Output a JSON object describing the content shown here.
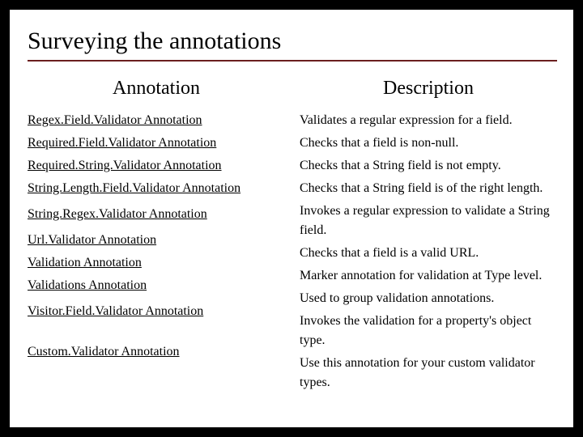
{
  "title": "Surveying the annotations",
  "headers": {
    "left": "Annotation",
    "right": "Description"
  },
  "rows": [
    {
      "annotation": "Regex.Field.Validator Annotation",
      "description": "Validates a regular expression for a field."
    },
    {
      "annotation": "Required.Field.Validator Annotation",
      "description": "Checks that a field is non-null."
    },
    {
      "annotation": "Required.String.Validator Annotation",
      "description": "Checks that a String field is not empty."
    },
    {
      "annotation": "String.Length.Field.Validator Annotation",
      "description": "Checks that a String field is of the right length."
    },
    {
      "annotation": "String.Regex.Validator Annotation",
      "description": "Invokes a regular expression to validate a String field."
    },
    {
      "annotation": "Url.Validator Annotation",
      "description": "Checks that a field is a valid URL."
    },
    {
      "annotation": "Validation Annotation",
      "description": "Marker annotation for validation at Type level."
    },
    {
      "annotation": "Validations Annotation",
      "description": "Used to group validation annotations."
    },
    {
      "annotation": "Visitor.Field.Validator Annotation",
      "description": "Invokes the validation for a property's object type."
    },
    {
      "annotation": "Custom.Validator Annotation",
      "description": "Use this annotation for your custom validator types."
    }
  ]
}
